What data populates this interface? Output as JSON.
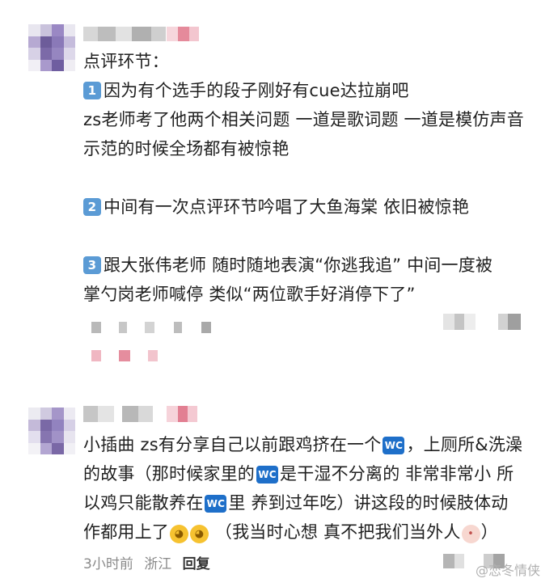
{
  "comments": [
    {
      "lines": {
        "l0": "点评环节：",
        "l1_badge": "1",
        "l1": "因为有个选手的段子刚好有cue达拉崩吧",
        "l2": "zs老师考了他两个相关问题 一道是歌词题 一道是模仿声音",
        "l3": "示范的时候全场都有被惊艳",
        "l4_badge": "2",
        "l4": "中间有一次点评环节吟唱了大鱼海棠 依旧被惊艳",
        "l5_badge": "3",
        "l5": "跟大张伟老师 随时随地表演“你逃我追” 中间一度被",
        "l6": "掌勺岗老师喊停 类似“两位歌手好消停下了”"
      }
    },
    {
      "lines": {
        "l0a": "小插曲 zs有分享自己以前跟鸡挤在一个",
        "l0b": "，上厕所&洗澡",
        "l1a": "的故事（那时候家里的",
        "l1b": "是干湿不分离的 非常非常小 所",
        "l2a": "以鸡只能散养在",
        "l2b": "里 养到过年吃）讲这段的时候肢体动",
        "l3a": "作都用上了",
        "l3b": " （我当时心想 真不把我们当外人",
        "l3c": "）"
      },
      "wc_label": "WC",
      "emoji_laugh": "rolling-on-floor-laughing-icon",
      "emoji_baby": "crying-baby-icon",
      "meta": {
        "time": "3小时前",
        "location": "浙江",
        "reply": "回复"
      }
    }
  ],
  "watermark": "@恋冬情侠"
}
